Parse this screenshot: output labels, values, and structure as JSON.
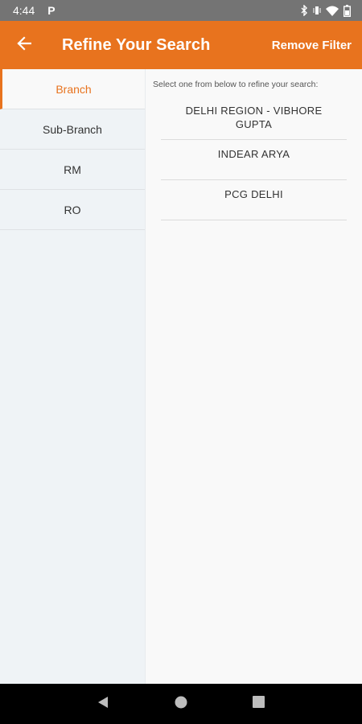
{
  "status_bar": {
    "time": "4:44",
    "app_badge": "P",
    "icons": [
      "bluetooth-icon",
      "vibrate-icon",
      "wifi-icon",
      "battery-icon"
    ]
  },
  "toolbar": {
    "title": "Refine Your Search",
    "remove_filter_label": "Remove Filter",
    "back_icon": "arrow-left-icon",
    "accent_color": "#e8731e"
  },
  "sidebar": {
    "items": [
      {
        "label": "Branch",
        "active": true
      },
      {
        "label": "Sub-Branch",
        "active": false
      },
      {
        "label": "RM",
        "active": false
      },
      {
        "label": "RO",
        "active": false
      }
    ]
  },
  "main": {
    "hint": "Select one from below to refine your search:",
    "options": [
      "DELHI REGION - VIBHORE GUPTA",
      "INDEAR ARYA",
      "PCG DELHI"
    ]
  },
  "nav_bar": {
    "buttons": [
      "back-triangle-icon",
      "home-circle-icon",
      "recents-square-icon"
    ]
  }
}
